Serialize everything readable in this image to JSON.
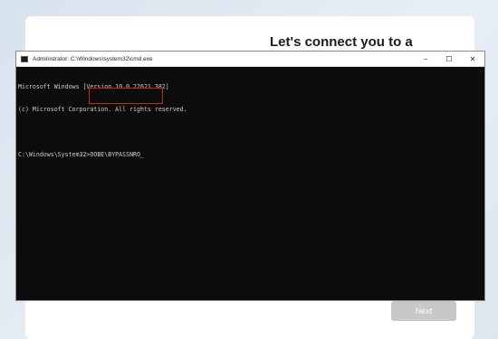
{
  "oobe": {
    "heading": "Let's connect you to a",
    "next_label": "Next"
  },
  "cmd": {
    "title": "Administrator: C:\\Windows\\system32\\cmd.exe",
    "controls": {
      "minimize": "–",
      "maximize": "☐",
      "close": "✕"
    },
    "lines": [
      "Microsoft Windows [Version 10.0.22621.382]",
      "(c) Microsoft Corporation. All rights reserved.",
      "",
      "C:\\Windows\\System32>OOBE\\BYPASSNRO"
    ],
    "cursor": "_"
  },
  "annotation": {
    "color": "#d01f1f"
  }
}
